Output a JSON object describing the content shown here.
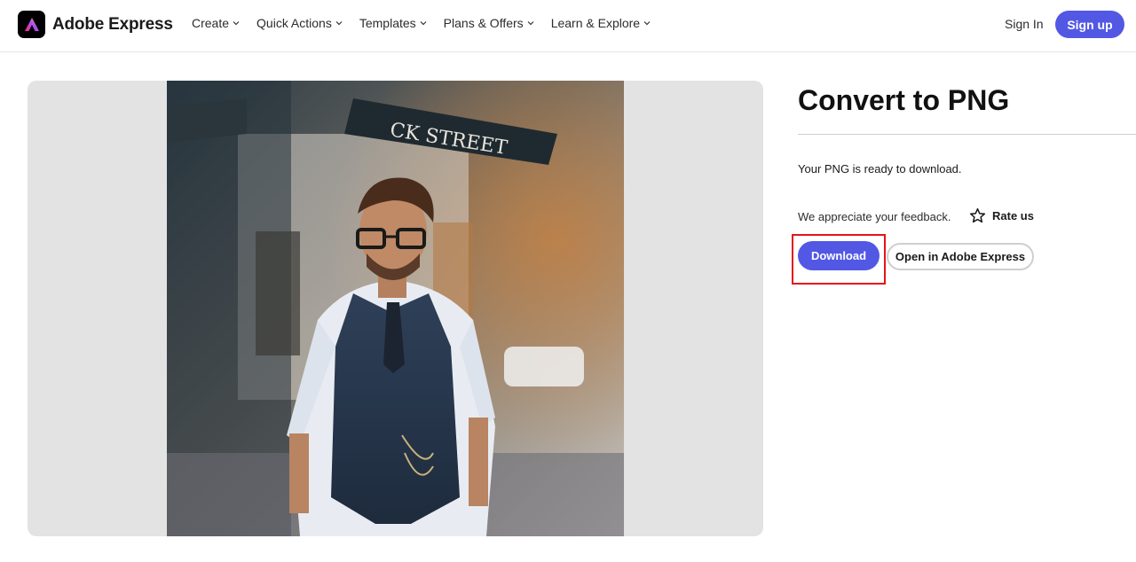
{
  "header": {
    "brand": "Adobe Express",
    "logo_icon": "adobe-express-logo",
    "nav": [
      {
        "label": "Create",
        "icon": "chevron-down-icon"
      },
      {
        "label": "Quick Actions",
        "icon": "chevron-down-icon"
      },
      {
        "label": "Templates",
        "icon": "chevron-down-icon"
      },
      {
        "label": "Plans & Offers",
        "icon": "chevron-down-icon"
      },
      {
        "label": "Learn & Explore",
        "icon": "chevron-down-icon"
      }
    ],
    "sign_in": "Sign In",
    "sign_up": "Sign up"
  },
  "colors": {
    "accent": "#5258e4",
    "highlight": "#e4141b",
    "preview_bg": "#e3e3e3"
  },
  "main": {
    "title": "Convert to PNG",
    "ready_text": "Your PNG is ready to download.",
    "feedback_text": "We appreciate your feedback.",
    "rate_label": "Rate us",
    "rate_icon": "star-icon",
    "download_label": "Download",
    "open_label": "Open in Adobe Express"
  },
  "preview": {
    "image": "converted-photo-preview"
  }
}
